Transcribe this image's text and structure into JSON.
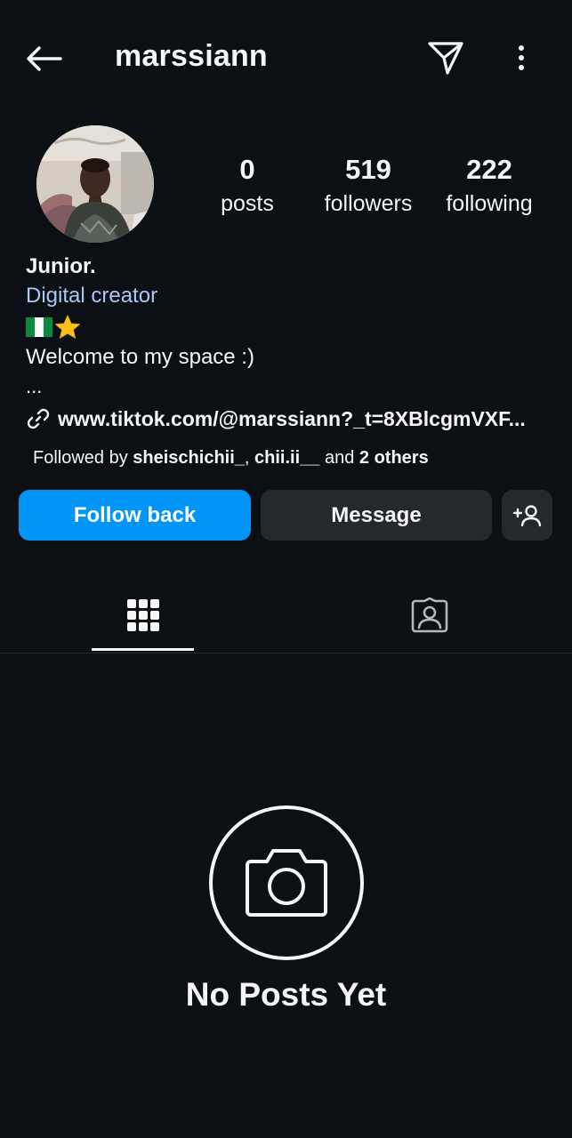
{
  "header": {
    "username": "marssiann",
    "icons": {
      "back": "arrow-left-icon",
      "send": "paper-plane-icon",
      "more": "more-vertical-icon"
    }
  },
  "profile": {
    "avatar": "profile-photo",
    "stats": {
      "posts": {
        "value": "0",
        "label": "posts"
      },
      "followers": {
        "value": "519",
        "label": "followers"
      },
      "following": {
        "value": "222",
        "label": "following"
      }
    },
    "name": "Junior.",
    "category": "Digital creator",
    "bio_emojis": [
      "nigeria-flag-emoji",
      "star-emoji"
    ],
    "bio_line": "Welcome to my space :)",
    "bio_more": "...",
    "link": "www.tiktok.com/@marssiann?_t=8XBlcgmVXF...",
    "followed_by": {
      "prefix": "Followed by",
      "user1": "sheischichii_",
      "separator": ",",
      "user2": "chii.ii__",
      "conjunction": "and",
      "others": "2 others"
    }
  },
  "actions": {
    "follow_back": "Follow back",
    "message": "Message",
    "suggest_icon": "add-person-icon"
  },
  "tabs": {
    "grid_icon": "grid-icon",
    "tagged_icon": "tagged-icon",
    "active": "grid"
  },
  "empty_state": {
    "icon": "camera-icon",
    "title": "No Posts Yet"
  },
  "colors": {
    "background": "#0c1014",
    "primary_button": "#0095f6",
    "secondary_button": "#25292e",
    "category_text": "#a9c8f3",
    "text": "#f5f5f5"
  }
}
